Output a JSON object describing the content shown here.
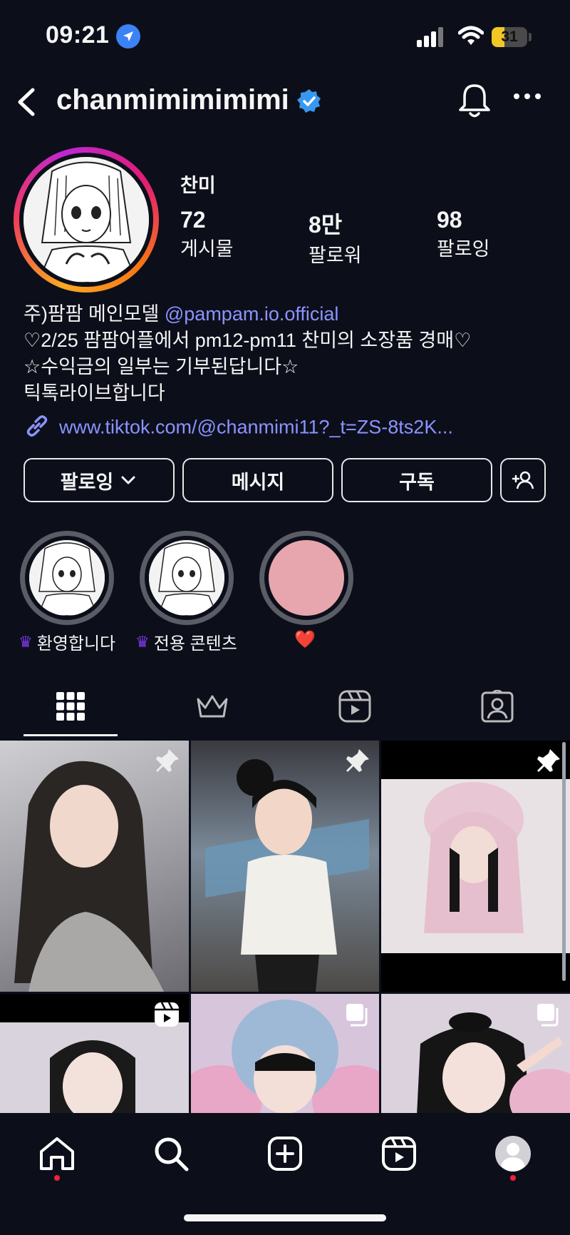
{
  "status_bar": {
    "time": "09:21",
    "battery": "31"
  },
  "header": {
    "username": "chanmimimimimi"
  },
  "profile": {
    "display_name": "찬미",
    "stats": [
      {
        "value": "72",
        "label": "게시물"
      },
      {
        "value": "8만",
        "label": "팔로워"
      },
      {
        "value": "98",
        "label": "팔로잉"
      }
    ],
    "bio": {
      "line1_prefix": "주)팜팜 메인모델 ",
      "line1_mention": "@pampam.io.official",
      "line2": "♡2/25 팜팜어플에서 pm12-pm11 찬미의 소장품 경매♡",
      "line3": "☆수익금의 일부는 기부된답니다☆",
      "line4": "틱톡라이브합니다"
    },
    "link": "www.tiktok.com/@chanmimi11?_t=ZS-8ts2K..."
  },
  "actions": {
    "following": "팔로잉",
    "message": "메시지",
    "subscribe": "구독"
  },
  "highlights": [
    {
      "label": "환영합니다",
      "crown": true
    },
    {
      "label": "전용 콘텐츠",
      "crown": true
    },
    {
      "label": "❤️",
      "crown": false
    }
  ],
  "tabs": [
    "grid-icon",
    "crown-icon",
    "reels-icon",
    "tagged-icon"
  ],
  "colors": {
    "background": "#0c0f1a",
    "accent": "#8b93ff",
    "verified": "#3897f0",
    "notification": "#ef233c"
  }
}
